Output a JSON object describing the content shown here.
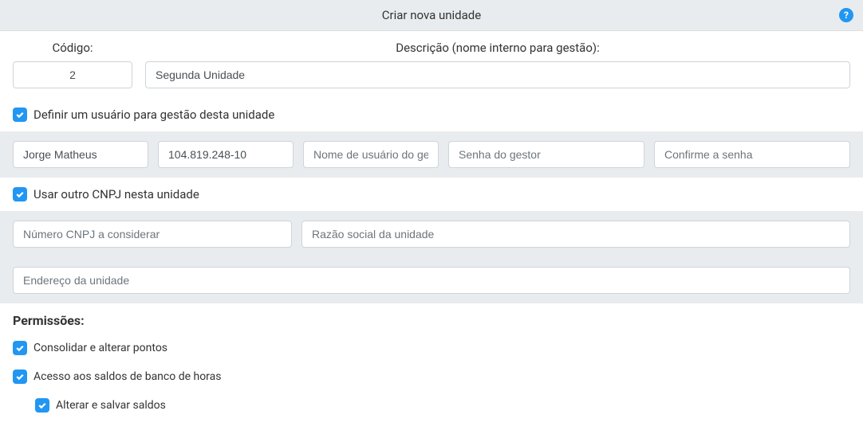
{
  "header": {
    "title": "Criar nova unidade"
  },
  "fields": {
    "codigo_label": "Código:",
    "codigo_value": "2",
    "descricao_label": "Descrição (nome interno para gestão):",
    "descricao_value": "Segunda Unidade"
  },
  "define_user": {
    "label": "Definir um usuário para gestão desta unidade",
    "name_value": "Jorge Matheus",
    "cpf_value": "104.819.248-10",
    "username_placeholder": "Nome de usuário do gestor",
    "password_placeholder": "Senha do gestor",
    "confirm_placeholder": "Confirme a senha"
  },
  "cnpj": {
    "label": "Usar outro CNPJ nesta unidade",
    "number_placeholder": "Número CNPJ a considerar",
    "razao_placeholder": "Razão social da unidade"
  },
  "address": {
    "placeholder": "Endereço da unidade"
  },
  "permissions": {
    "title": "Permissões:",
    "items": {
      "consolidar": "Consolidar e alterar pontos",
      "acesso_saldos": "Acesso aos saldos de banco de horas",
      "alterar_saldos": "Alterar e salvar saldos"
    }
  }
}
